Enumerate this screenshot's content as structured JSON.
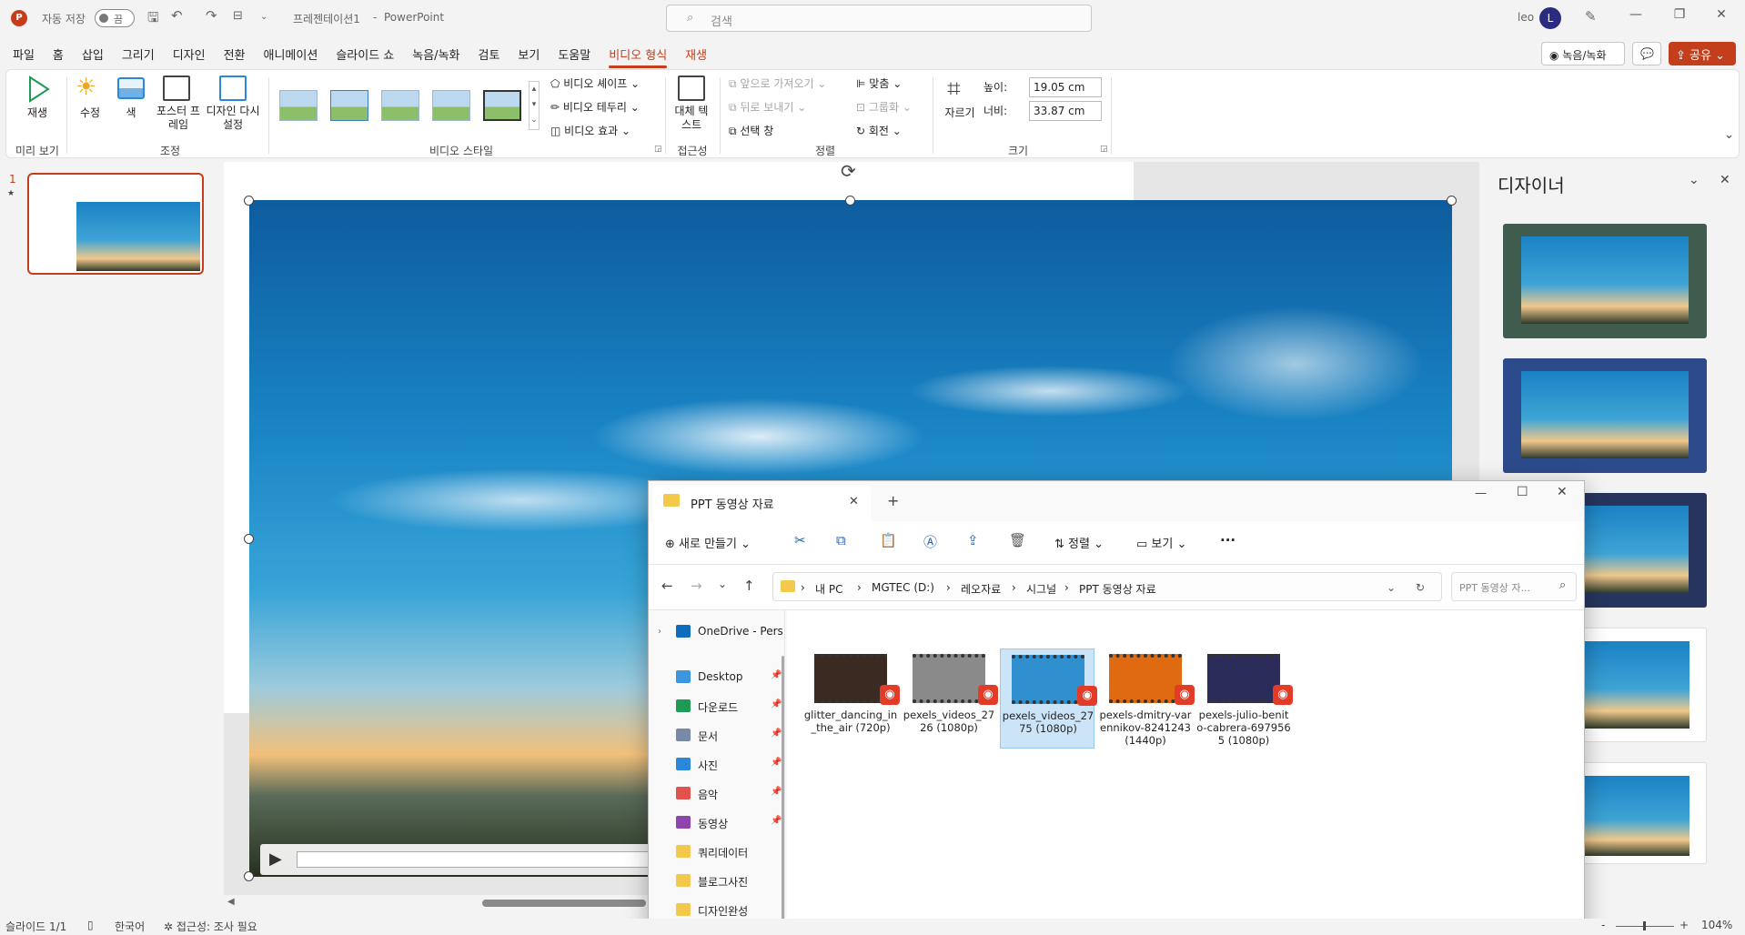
{
  "titlebar": {
    "autosave_label": "자동 저장",
    "autosave_state": "끔",
    "doc_title": "프레젠테이션1",
    "app_name": "PowerPoint",
    "separator": "-",
    "search_placeholder": "검색",
    "user_name": "leo",
    "user_initial": "L"
  },
  "menu": {
    "tabs": [
      "파일",
      "홈",
      "삽입",
      "그리기",
      "디자인",
      "전환",
      "애니메이션",
      "슬라이드 쇼",
      "녹음/녹화",
      "검토",
      "보기",
      "도움말",
      "비디오 형식",
      "재생"
    ],
    "active_tab": "비디오 형식",
    "record_button": "녹음/녹화",
    "share_button": "공유"
  },
  "ribbon": {
    "preview": {
      "play_label": "재생",
      "group": "미리 보기"
    },
    "adjust": {
      "correct": "수정",
      "color": "색",
      "poster_frame": "포스터 프레임",
      "redesign": "디자인 다시 설정",
      "group": "조정"
    },
    "video_styles": {
      "shape": "비디오 셰이프",
      "border": "비디오 테두리",
      "effects": "비디오 효과",
      "group": "비디오 스타일"
    },
    "accessibility": {
      "alt_text": "대체 텍스트",
      "group": "접근성"
    },
    "arrange": {
      "bring_forward": "앞으로 가져오기",
      "send_backward": "뒤로 보내기",
      "selection_pane": "선택 창",
      "align": "맞춤",
      "group_btn": "그룹화",
      "rotate": "회전",
      "group": "정렬"
    },
    "size": {
      "crop": "자르기",
      "height_label": "높이:",
      "height_value": "19.05 cm",
      "width_label": "너비:",
      "width_value": "33.87 cm",
      "group": "크기"
    }
  },
  "slides_pane": {
    "slide_number": "1",
    "star": "★"
  },
  "designer": {
    "title": "디자이너"
  },
  "explorer": {
    "tab_title": "PPT 동영상 자료",
    "toolbar": {
      "new": "새로 만들기",
      "sort": "정렬",
      "view": "보기",
      "more": "···"
    },
    "breadcrumbs": [
      "내 PC",
      "MGTEC (D:)",
      "레오자료",
      "시그널",
      "PPT 동영상 자료"
    ],
    "search_placeholder": "PPT 동영상 자...",
    "nav": [
      {
        "label": "OneDrive - Pers",
        "icon": "cloud-icon",
        "color": "#0f6cbd",
        "pinned": false
      },
      {
        "label": "Desktop",
        "icon": "desktop-icon",
        "color": "#3a96dd",
        "pinned": true
      },
      {
        "label": "다운로드",
        "icon": "download-icon",
        "color": "#1f9a55",
        "pinned": true
      },
      {
        "label": "문서",
        "icon": "document-icon",
        "color": "#7a8aa6",
        "pinned": true
      },
      {
        "label": "사진",
        "icon": "photo-icon",
        "color": "#2b88d8",
        "pinned": true
      },
      {
        "label": "음악",
        "icon": "music-icon",
        "color": "#e0524b",
        "pinned": true
      },
      {
        "label": "동영상",
        "icon": "video-icon",
        "color": "#8e44ad",
        "pinned": true
      },
      {
        "label": "쿼리데이터",
        "icon": "folder-icon",
        "color": "#f2c94c",
        "pinned": false
      },
      {
        "label": "블로그사진",
        "icon": "folder-icon",
        "color": "#f2c94c",
        "pinned": false
      },
      {
        "label": "디자인완성",
        "icon": "folder-icon",
        "color": "#f2c94c",
        "pinned": false
      }
    ],
    "files": [
      {
        "name": "glitter_dancing_in_the_air (720p)",
        "thumb": "#3a2a22",
        "selected": false
      },
      {
        "name": "pexels_videos_2726 (1080p)",
        "thumb": "#8a8a8a",
        "selected": false
      },
      {
        "name": "pexels_videos_2775 (1080p)",
        "thumb": "#2f8fcf",
        "selected": true
      },
      {
        "name": "pexels-dmitry-varennikov-8241243 (1440p)",
        "thumb": "#e06a12",
        "selected": false
      },
      {
        "name": "pexels-julio-benito-cabrera-6979565 (1080p)",
        "thumb": "#2c2c5a",
        "selected": false
      }
    ]
  },
  "statusbar": {
    "slide_info": "슬라이드 1/1",
    "language": "한국어",
    "accessibility": "접근성: 조사 필요",
    "zoom": "104%",
    "zoom_minus": "-",
    "zoom_plus": "+"
  },
  "colors": {
    "accent": "#c43e1c",
    "selection": "#cce4f7"
  }
}
